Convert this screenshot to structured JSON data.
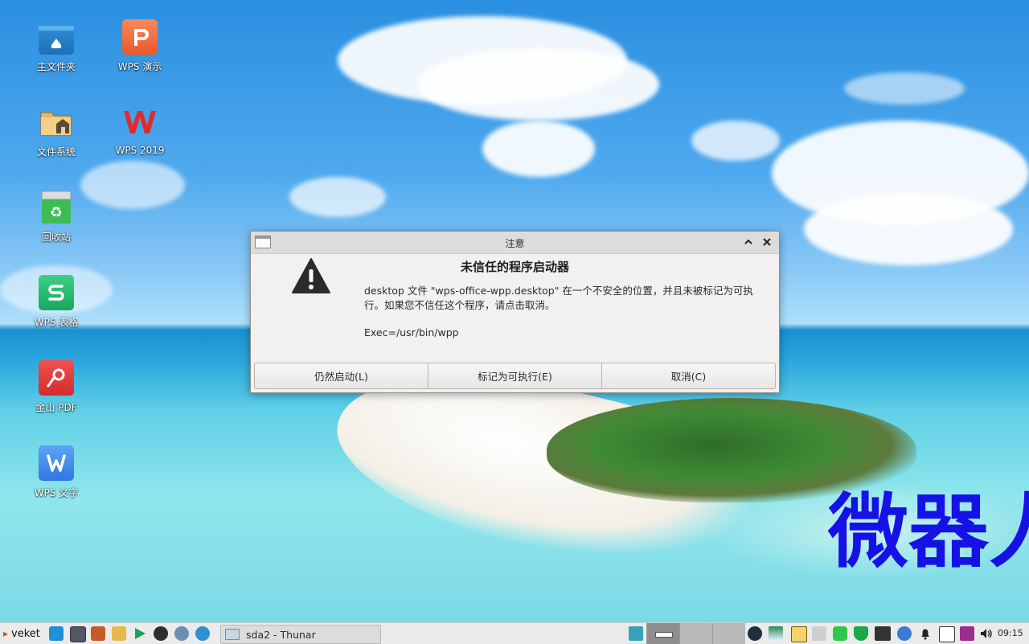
{
  "desktop": {
    "icons": [
      {
        "label": "主文件夹"
      },
      {
        "label": "WPS 演示"
      },
      {
        "label": "文件系统"
      },
      {
        "label": "WPS 2019"
      },
      {
        "label": "回收站"
      },
      {
        "label": "WPS 表格"
      },
      {
        "label": "金山 PDF"
      },
      {
        "label": "WPS 文字"
      }
    ],
    "watermark_text": "微器人",
    "colors": {
      "watermark": "#1612e6"
    }
  },
  "dialog": {
    "title": "注意",
    "heading": "未信任的程序启动器",
    "message": "desktop 文件 \"wps-office-wpp.desktop\" 在一个不安全的位置，并且未被标记为可执行。如果您不信任这个程序，请点击取消。",
    "exec": "Exec=/usr/bin/wpp",
    "buttons": {
      "launch_anyway": "仍然启动(L)",
      "mark_executable": "标记为可执行(E)",
      "cancel": "取消(C)"
    }
  },
  "taskbar": {
    "menu_label": "veket",
    "task": {
      "label": "sda2 - Thunar"
    },
    "clock": "09:15"
  }
}
